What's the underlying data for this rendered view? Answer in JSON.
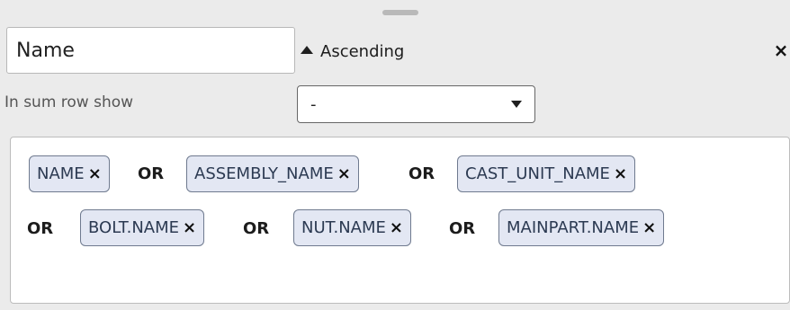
{
  "field_input": {
    "value": "Name"
  },
  "sort": {
    "label": "Ascending",
    "icon": "triangle-up-icon"
  },
  "close": {
    "icon": "close-icon",
    "glyph": "×"
  },
  "sum_row": {
    "label": "In sum row show",
    "selected": "-"
  },
  "filter": {
    "tags": [
      {
        "label": "NAME"
      },
      {
        "label": "ASSEMBLY_NAME"
      },
      {
        "label": "CAST_UNIT_NAME"
      },
      {
        "label": "BOLT.NAME"
      },
      {
        "label": "NUT.NAME"
      },
      {
        "label": "MAINPART.NAME"
      }
    ],
    "operator": "OR",
    "remove_glyph": "×"
  }
}
